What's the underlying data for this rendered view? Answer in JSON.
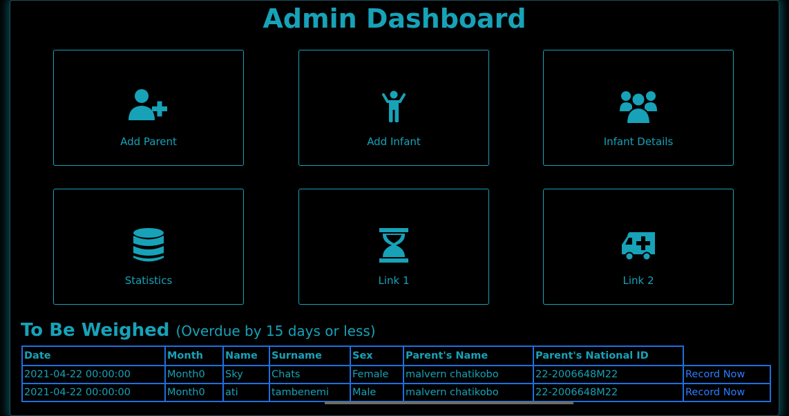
{
  "page": {
    "title": "Admin Dashboard"
  },
  "cards": [
    {
      "label": "Add Parent",
      "icon": "add-user-icon"
    },
    {
      "label": "Add Infant",
      "icon": "child-icon"
    },
    {
      "label": "Infant Details",
      "icon": "users-icon"
    },
    {
      "label": "Statistics",
      "icon": "database-icon"
    },
    {
      "label": "Link 1",
      "icon": "hourglass-icon"
    },
    {
      "label": "Link 2",
      "icon": "ambulance-icon"
    }
  ],
  "weigh": {
    "title": "To Be Weighed",
    "subtitle": "(Overdue by 15 days or less)",
    "columns": [
      "Date",
      "Month",
      "Name",
      "Surname",
      "Sex",
      "Parent's Name",
      "Parent's National ID"
    ],
    "rows": [
      {
        "date": "2021-04-22 00:00:00",
        "month": "Month0",
        "name": "Sky",
        "surname": "Chats",
        "sex": "Female",
        "parent_name": "malvern chatikobo",
        "parent_id": "22-2006648M22",
        "action": "Record Now"
      },
      {
        "date": "2021-04-22 00:00:00",
        "month": "Month0",
        "name": "ati",
        "surname": "tambenemi",
        "sex": "Male",
        "parent_name": "malvern chatikobo",
        "parent_id": "22-2006648M22",
        "action": "Record Now"
      }
    ]
  },
  "colors": {
    "accent": "#17a2b8",
    "background": "#000000",
    "table_border": "#1e6fe0",
    "link": "#2b7bff"
  }
}
